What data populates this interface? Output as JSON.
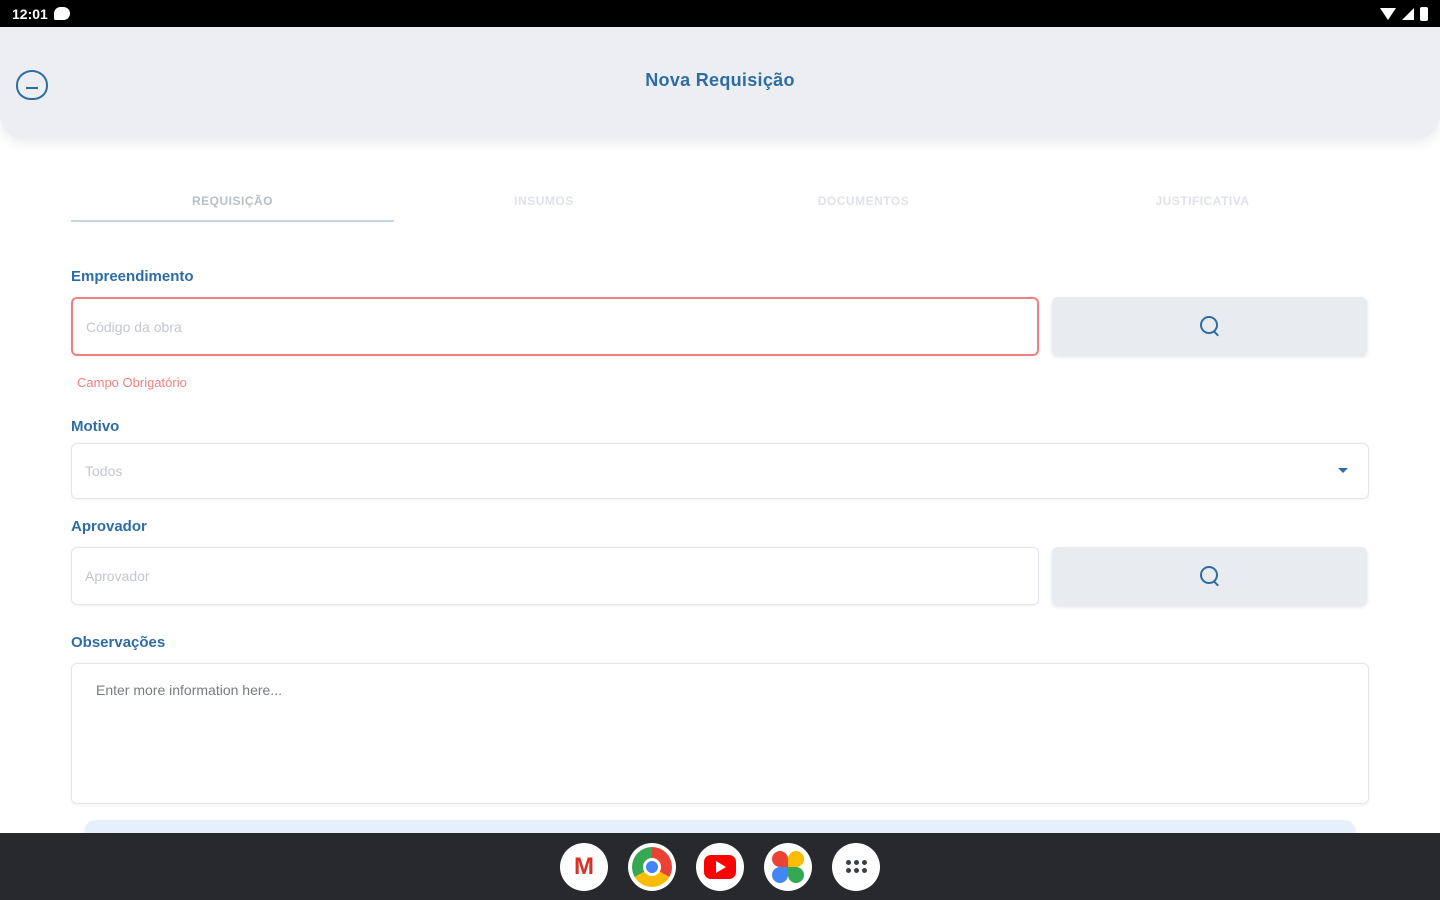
{
  "status_bar": {
    "time": "12:01"
  },
  "header": {
    "title": "Nova Requisição"
  },
  "tabs": [
    {
      "label": "REQUISIÇÃO",
      "active": true
    },
    {
      "label": "INSUMOS",
      "active": false
    },
    {
      "label": "DOCUMENTOS",
      "active": false
    },
    {
      "label": "JUSTIFICATIVA",
      "active": false
    }
  ],
  "form": {
    "empreendimento": {
      "label": "Empreendimento",
      "placeholder": "Código da obra",
      "error": "Campo Obrigatório"
    },
    "motivo": {
      "label": "Motivo",
      "selected": "Todos"
    },
    "aprovador": {
      "label": "Aprovador",
      "placeholder": "Aprovador"
    },
    "observacoes": {
      "label": "Observações",
      "placeholder": "Enter more information here..."
    }
  },
  "colors": {
    "accent": "#2e6da4",
    "error": "#f08080",
    "header_bg": "#eceef1"
  },
  "dock": [
    {
      "name": "gmail-icon"
    },
    {
      "name": "chrome-icon"
    },
    {
      "name": "youtube-icon"
    },
    {
      "name": "photos-icon"
    },
    {
      "name": "apps-icon"
    }
  ]
}
